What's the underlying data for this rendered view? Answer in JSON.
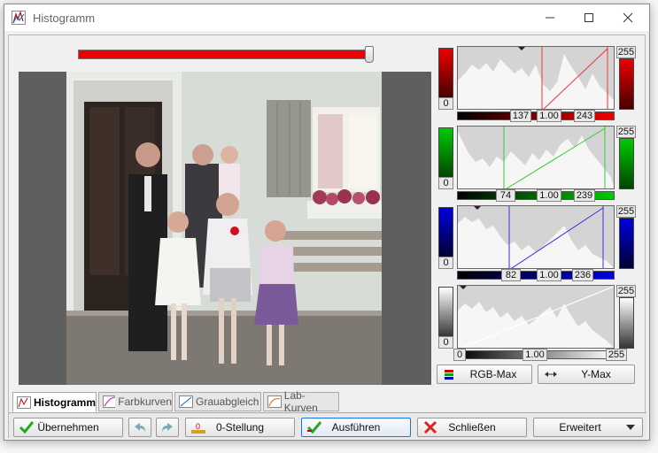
{
  "window": {
    "title": "Histogramm",
    "minimize_icon": "minimize-icon",
    "maximize_icon": "maximize-icon",
    "close_icon": "close-icon"
  },
  "colors": {
    "red": "#dd0000",
    "green": "#00bb00",
    "blue": "#0000cc",
    "accent": "#1a73e8"
  },
  "slider": {
    "value_fraction": 0.99
  },
  "channels": {
    "red": {
      "min": "0",
      "max": "255",
      "low": "137",
      "gamma": "1.00",
      "high": "243"
    },
    "green": {
      "min": "0",
      "max": "255",
      "low": "74",
      "gamma": "1.00",
      "high": "239"
    },
    "blue": {
      "min": "0",
      "max": "255",
      "low": "82",
      "gamma": "1.00",
      "high": "236"
    },
    "gray": {
      "min": "0",
      "max": "255",
      "low": "0",
      "gamma": "1.00",
      "high": "255"
    }
  },
  "buttons": {
    "rgb_max": "RGB-Max",
    "y_max": "Y-Max"
  },
  "tabs": [
    {
      "label": "Histogramm",
      "icon": "histogram-icon",
      "active": true
    },
    {
      "label": "Farbkurven",
      "icon": "color-curves-icon",
      "active": false
    },
    {
      "label": "Grauabgleich",
      "icon": "gray-balance-icon",
      "active": false
    },
    {
      "label": "Lab-Kurven",
      "icon": "lab-curves-icon",
      "active": false
    }
  ],
  "bottom": {
    "apply": "Übernehmen",
    "zero_position": "0-Stellung",
    "zero_icon_text": "0",
    "execute": "Ausführen",
    "close": "Schließen",
    "extended": "Erweitert"
  }
}
